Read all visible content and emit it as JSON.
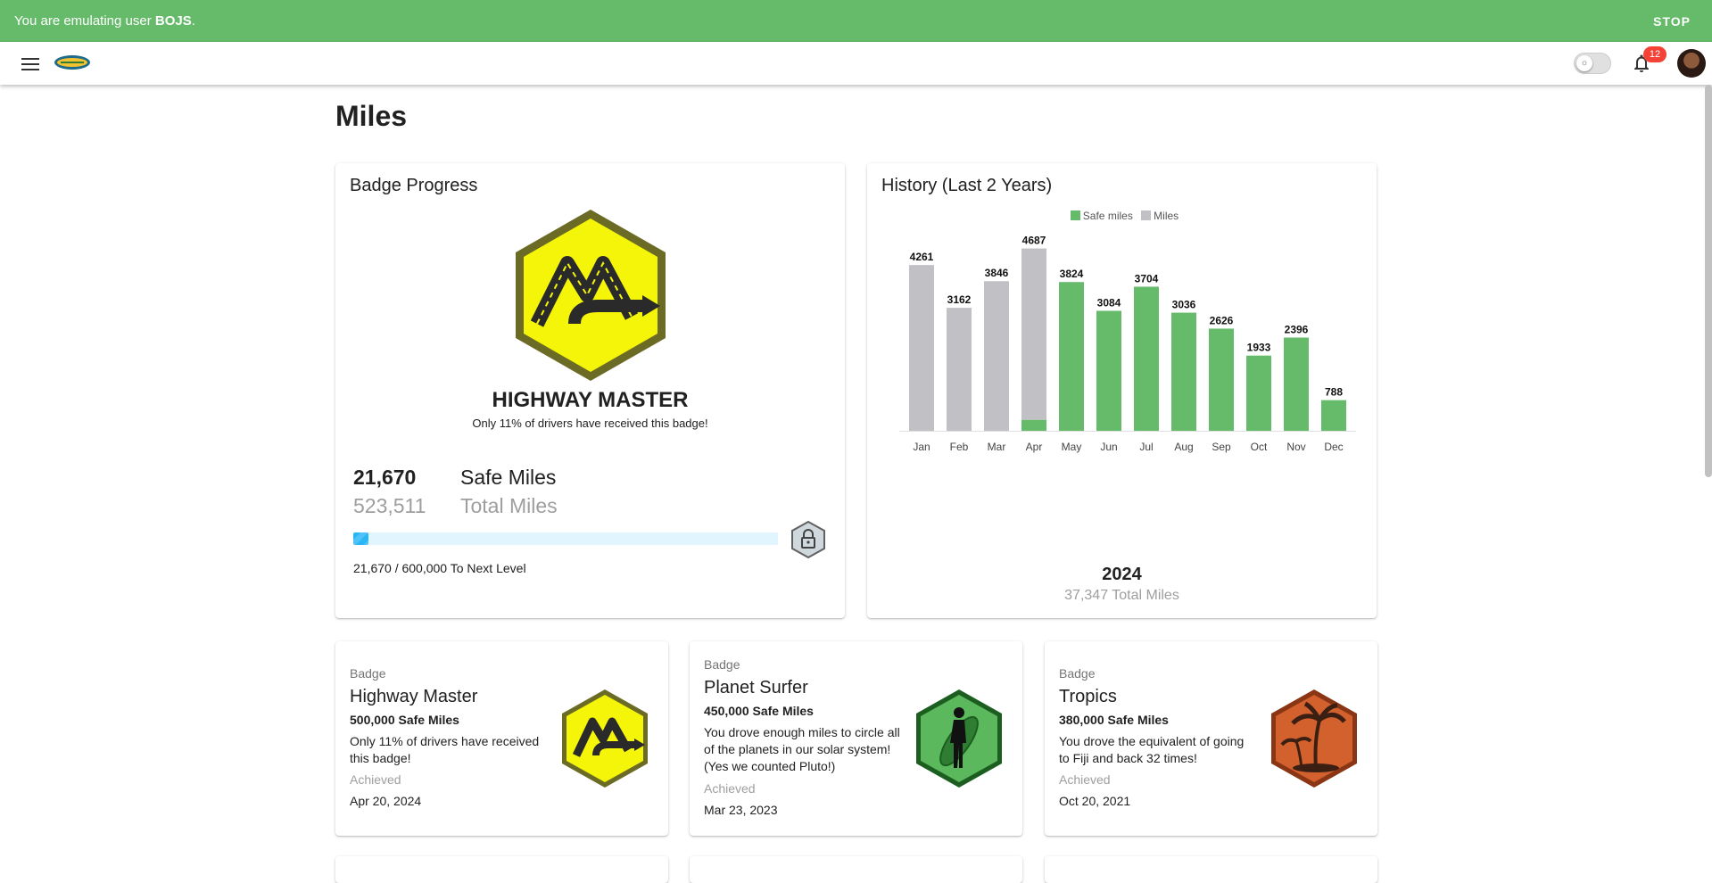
{
  "banner": {
    "prefix": "You are emulating user ",
    "user": "BOJS",
    "suffix": ".",
    "stop_label": "STOP"
  },
  "header": {
    "notification_count": "12",
    "theme_toggle_icon": "sun-icon"
  },
  "page": {
    "title": "Miles"
  },
  "badge_progress": {
    "title": "Badge Progress",
    "badge_name": "HIGHWAY MASTER",
    "badge_subtitle": "Only 11% of drivers have received this badge!",
    "safe_miles_value": "21,670",
    "safe_miles_label": "Safe Miles",
    "total_miles_value": "523,511",
    "total_miles_label": "Total Miles",
    "progress_fraction": 0.036,
    "next_level_text": "21,670 / 600,000 To Next Level",
    "badge_color": "#f5f50a"
  },
  "history": {
    "title": "History (Last 2 Years)",
    "year": "2024",
    "total_text": "37,347 Total Miles",
    "chart_data": {
      "type": "bar",
      "categories": [
        "Jan",
        "Feb",
        "Mar",
        "Apr",
        "May",
        "Jun",
        "Jul",
        "Aug",
        "Sep",
        "Oct",
        "Nov",
        "Dec"
      ],
      "series": [
        {
          "name": "Safe miles",
          "color": "#66bb6a",
          "values": [
            0,
            0,
            0,
            280,
            3824,
            3084,
            3704,
            3036,
            2626,
            1933,
            2396,
            788
          ]
        },
        {
          "name": "Miles",
          "color": "#c1c1c5",
          "values": [
            4261,
            3162,
            3846,
            4687,
            3824,
            3084,
            3704,
            3036,
            2626,
            1933,
            2396,
            788
          ]
        }
      ],
      "data_labels": [
        "4261",
        "3162",
        "3846",
        "4687",
        "3824",
        "3084",
        "3704",
        "3036",
        "2626",
        "1933",
        "2396",
        "788"
      ],
      "ylim": [
        0,
        4700
      ],
      "legend": "top-center",
      "grid": false
    }
  },
  "badges": [
    {
      "label": "Badge",
      "name": "Highway Master",
      "requirement": "500,000 Safe Miles",
      "description": "Only 11% of drivers have received this badge!",
      "achieved_label": "Achieved",
      "date": "Apr 20, 2024",
      "icon": "highway-icon",
      "color": "#f5f50a"
    },
    {
      "label": "Badge",
      "name": "Planet Surfer",
      "requirement": "450,000 Safe Miles",
      "description": "You drove enough miles to circle all of the planets in our solar system! (Yes we counted Pluto!)",
      "achieved_label": "Achieved",
      "date": "Mar 23, 2023",
      "icon": "surfer-icon",
      "color": "#4caf50"
    },
    {
      "label": "Badge",
      "name": "Tropics",
      "requirement": "380,000 Safe Miles",
      "description": "You drove the equivalent of going to Fiji and back 32 times!",
      "achieved_label": "Achieved",
      "date": "Oct 20, 2021",
      "icon": "palm-tree-icon",
      "color": "#d2612e"
    }
  ]
}
